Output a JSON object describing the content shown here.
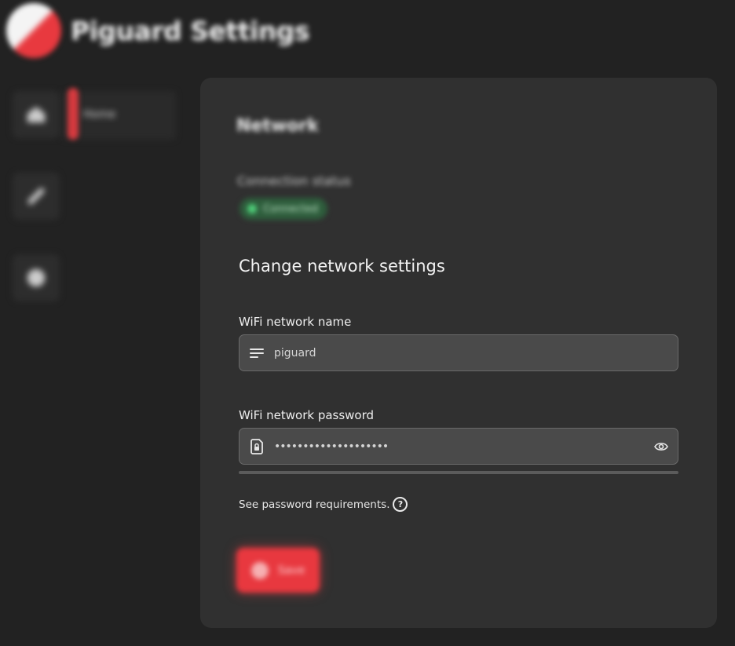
{
  "app": {
    "title": "Piguard Settings"
  },
  "sidebar": {
    "items": [
      {
        "icon": "home-icon",
        "label": "Home",
        "active": true
      },
      {
        "icon": "link-icon",
        "label": ""
      },
      {
        "icon": "settings-icon",
        "label": ""
      }
    ]
  },
  "network": {
    "section_title": "Network",
    "status_label": "Connection status",
    "status_value": "Connected",
    "status_color": "#4fd07a",
    "change_title": "Change network settings",
    "ssid_label": "WiFi network name",
    "ssid_value": "piguard",
    "password_label": "WiFi network password",
    "password_value": "••••••••••••••••••••",
    "requirements_link": "See password requirements.",
    "save_label": "Save"
  },
  "colors": {
    "accent": "#e8383f",
    "background": "#222222",
    "card": "#303030",
    "field": "#4a4a4a"
  }
}
